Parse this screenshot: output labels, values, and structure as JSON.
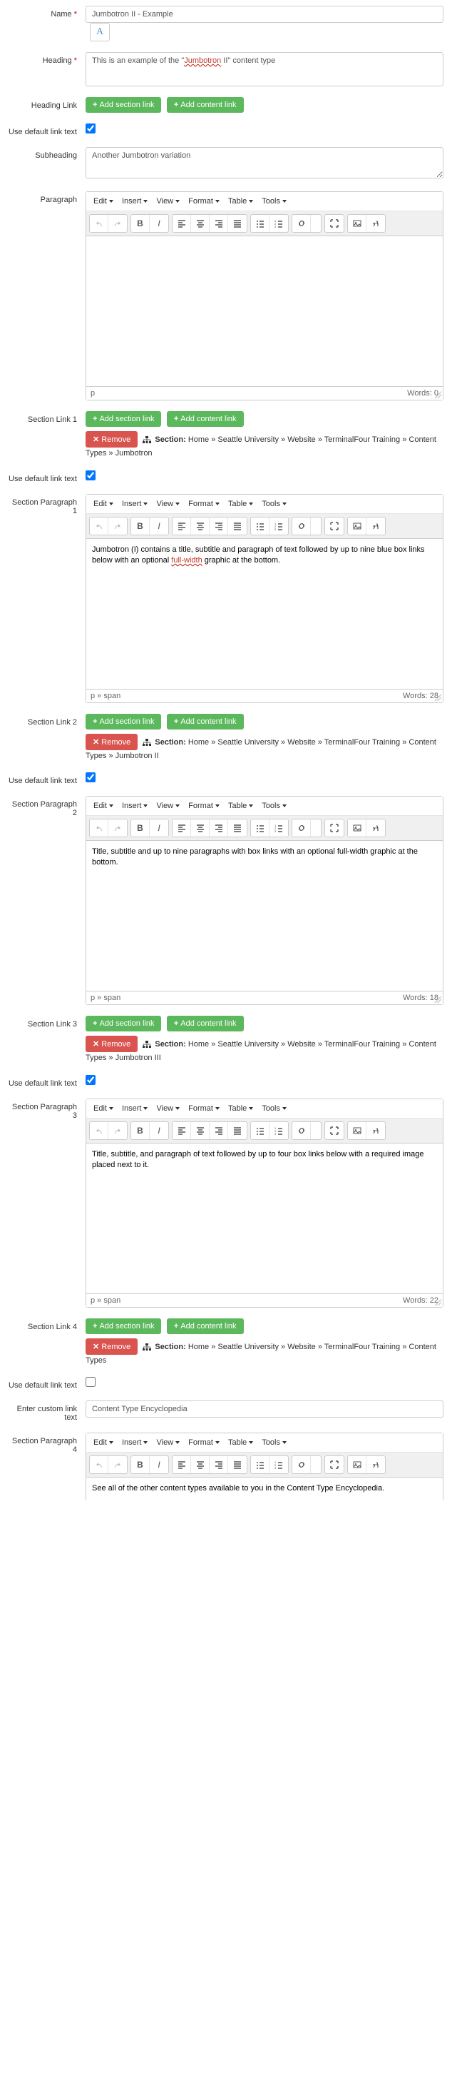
{
  "labels": {
    "name": "Name",
    "heading": "Heading",
    "heading_link": "Heading Link",
    "use_default_link_text": "Use default link text",
    "subheading": "Subheading",
    "paragraph": "Paragraph",
    "section_link_1": "Section Link 1",
    "section_paragraph_1": "Section Paragraph 1",
    "section_link_2": "Section Link 2",
    "section_paragraph_2": "Section Paragraph 2",
    "section_link_3": "Section Link 3",
    "section_paragraph_3": "Section Paragraph 3",
    "section_link_4": "Section Link 4",
    "section_paragraph_4": "Section Paragraph 4",
    "enter_custom_link_text": "Enter custom link text",
    "required": "*"
  },
  "buttons": {
    "add_section_link": "Add section link",
    "add_content_link": "Add content link",
    "remove": "Remove"
  },
  "lang_indicator": "A",
  "editor_menu": [
    "Edit",
    "Insert",
    "View",
    "Format",
    "Table",
    "Tools"
  ],
  "editor_status": {
    "p": "p",
    "p_span": "p » span",
    "words_prefix": "Words: "
  },
  "name_value": "Jumbotron II - Example",
  "heading_text_before": "This is an example of the \"",
  "heading_text_highlight": "Jumbotron",
  "heading_text_after": " II\" content type",
  "subheading_value": "Another Jumbotron variation",
  "paragraph_body": "",
  "paragraph_words": 0,
  "section1": {
    "breadcrumb_label": "Section:",
    "breadcrumb_path": " Home » Seattle University » Website » TerminalFour Training » Content Types » Jumbotron",
    "body_before": "Jumbotron (I) contains a title, subtitle and paragraph of text followed by up to nine blue box links below with an optional ",
    "body_highlight": "full-width",
    "body_after": " graphic at the bottom.",
    "words": 28
  },
  "section2": {
    "breadcrumb_label": "Section:",
    "breadcrumb_path": " Home » Seattle University » Website » TerminalFour Training » Content Types » Jumbotron II",
    "body": "Title, subtitle and up to nine paragraphs with box links with an optional full-width graphic at the bottom.",
    "words": 18
  },
  "section3": {
    "breadcrumb_label": "Section:",
    "breadcrumb_path": " Home » Seattle University » Website » TerminalFour Training » Content Types » Jumbotron III",
    "body": "Title, subtitle, and paragraph of text followed by up to four box links below with a required image placed next to it.",
    "words": 22
  },
  "section4": {
    "breadcrumb_label": "Section:",
    "breadcrumb_path": " Home » Seattle University » Website » TerminalFour Training » Content Types",
    "custom_link_text": "Content Type Encyclopedia",
    "body": "See all of the other content types available to you in the Content Type Encyclopedia."
  }
}
